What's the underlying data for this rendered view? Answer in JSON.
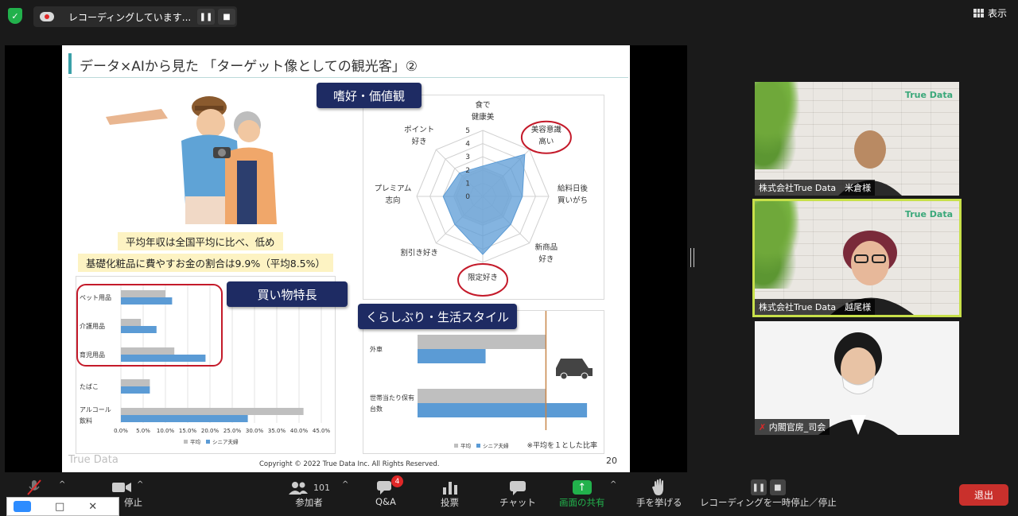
{
  "topbar": {
    "recording_text": "レコーディングしています...",
    "pause_glyph": "❚❚",
    "stop_glyph": "■",
    "view_label": "表示"
  },
  "slide": {
    "title": "データ×AIから見た 「ターゲット像としての観光客」②",
    "income_note": "平均年収は全国平均に比べ、低め",
    "cosmetics_note": "基礎化粧品に費やすお金の割合は9.9%（平均8.5%）",
    "label_preferences": "嗜好・価値観",
    "label_shopping": "買い物特長",
    "label_lifestyle": "くらしぶり・生活スタイル",
    "copyright": "Copyright © 2022 True Data Inc. All Rights Reserved.",
    "page_number": "20",
    "logo_text": "True Data"
  },
  "chart_data": [
    {
      "type": "radar",
      "title": "",
      "axes": [
        "食で健康美",
        "美容意識高い",
        "給料日後買いがち",
        "新商品好き",
        "限定好き",
        "割引き好き",
        "プレミアム志向",
        "ポイント好き"
      ],
      "axis_lines": [
        [
          "食で",
          "健康美"
        ],
        [
          "美容意識",
          "高い"
        ],
        [
          "給料日後",
          "買いがち"
        ],
        [
          "新商品",
          "好き"
        ],
        [
          "限定好き"
        ],
        [
          "割引き好き"
        ],
        [
          "プレミアム",
          "志向"
        ],
        [
          "ポイント",
          "好き"
        ]
      ],
      "ticks": [
        "0",
        "1",
        "2",
        "3",
        "4",
        "5"
      ],
      "rmax": 5,
      "series": [
        {
          "values": [
            2.2,
            2.2,
            2.2,
            2.2,
            2.2,
            2.2,
            2.2,
            2.2
          ],
          "color": "#d9d9d9"
        },
        {
          "values": [
            2.3,
            4.5,
            3.0,
            3.0,
            4.4,
            3.0,
            3.0,
            2.5
          ],
          "color": "#5b9bd5"
        }
      ],
      "highlighted_axes": [
        "美容意識高い",
        "限定好き"
      ]
    },
    {
      "type": "bar",
      "orientation": "horizontal",
      "title": "",
      "categories": [
        "ペット用品",
        "介護用品",
        "育児用品",
        "たばこ",
        "アルコール飲料"
      ],
      "category_lines": [
        [
          "ペット用品"
        ],
        [
          "介護用品"
        ],
        [
          "育児用品"
        ],
        [
          "たばこ"
        ],
        [
          "アルコール",
          "飲料"
        ]
      ],
      "series": [
        {
          "name": "平均",
          "values": [
            10.0,
            4.5,
            12.0,
            6.5,
            41.0
          ],
          "color": "#bfbfbf"
        },
        {
          "name": "シニア夫婦",
          "values": [
            11.5,
            8.0,
            19.0,
            6.5,
            28.5
          ],
          "color": "#5b9bd5"
        }
      ],
      "xticks": [
        "0.0%",
        "5.0%",
        "10.0%",
        "15.0%",
        "20.0%",
        "25.0%",
        "30.0%",
        "35.0%",
        "40.0%",
        "45.0%"
      ],
      "xlim": [
        0,
        45
      ],
      "legend": "bottom"
    },
    {
      "type": "bar",
      "orientation": "horizontal",
      "title": "",
      "categories": [
        "外車",
        "世帯当たり保有台数"
      ],
      "category_lines": [
        [
          "外車"
        ],
        [
          "世帯当たり保有",
          "台数"
        ]
      ],
      "series": [
        {
          "name": "平均",
          "values": [
            1.0,
            1.0
          ],
          "color": "#bfbfbf"
        },
        {
          "name": "シニア夫婦",
          "values": [
            0.53,
            1.32
          ],
          "color": "#5b9bd5"
        }
      ],
      "reference_line": 1.0,
      "xlim": [
        0,
        1.4
      ],
      "legend": "bottom",
      "note": "※平均を１とした比率"
    }
  ],
  "participants": [
    {
      "label": "株式会社True Data　米倉様",
      "logo": "True Data"
    },
    {
      "label": "株式会社True Data　越尾様",
      "logo": "True Data"
    },
    {
      "label": "内閣官房_司会"
    }
  ],
  "toolbar": {
    "stop_video_fragment": "停止",
    "participants_label": "参加者",
    "participants_count": "101",
    "qa_label": "Q&A",
    "qa_badge": "4",
    "poll_label": "投票",
    "chat_label": "チャット",
    "share_label": "画面の共有",
    "raise_hand_label": "手を挙げる",
    "recording_label": "レコーディングを一時停止／停止",
    "leave_label": "退出"
  }
}
